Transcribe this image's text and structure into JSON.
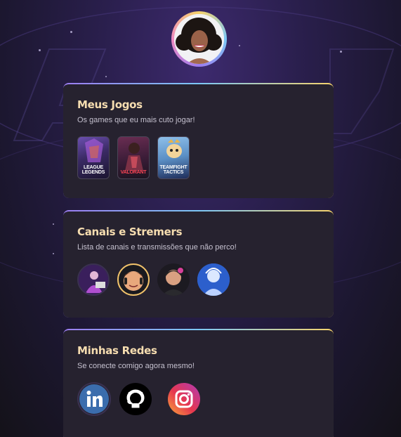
{
  "profile": {
    "avatar_icon": "profile-photo"
  },
  "games_card": {
    "title": "Meus Jogos",
    "subtitle": "Os games que eu mais cuto jogar!",
    "games": [
      {
        "name": "League of Legends",
        "label_line1": "LEAGUE",
        "label_line2": "LEGENDS"
      },
      {
        "name": "Valorant",
        "label_line1": "VALORANT",
        "label_line2": ""
      },
      {
        "name": "Teamfight Tactics",
        "label_line1": "TEAMFIGHT",
        "label_line2": "TACTICS"
      }
    ]
  },
  "streamers_card": {
    "title": "Canais e Stremers",
    "subtitle": "Lista de canais e transmissões que não perco!",
    "streamers": [
      "streamer-1",
      "streamer-2",
      "streamer-3",
      "streamer-4"
    ]
  },
  "social_card": {
    "title": "Minhas Redes",
    "subtitle": "Se conecte comigo agora mesmo!",
    "networks": [
      {
        "name": "LinkedIn",
        "icon": "linkedin-icon",
        "text": "in",
        "color": "#3b6dad"
      },
      {
        "name": "GitHub",
        "icon": "github-icon",
        "color": "#000000"
      },
      {
        "name": "Instagram",
        "icon": "instagram-icon",
        "color": "#e1306c"
      }
    ]
  },
  "colors": {
    "accent": "#f6ddb0",
    "card": "#26222f",
    "background": "#2a1f4d"
  }
}
